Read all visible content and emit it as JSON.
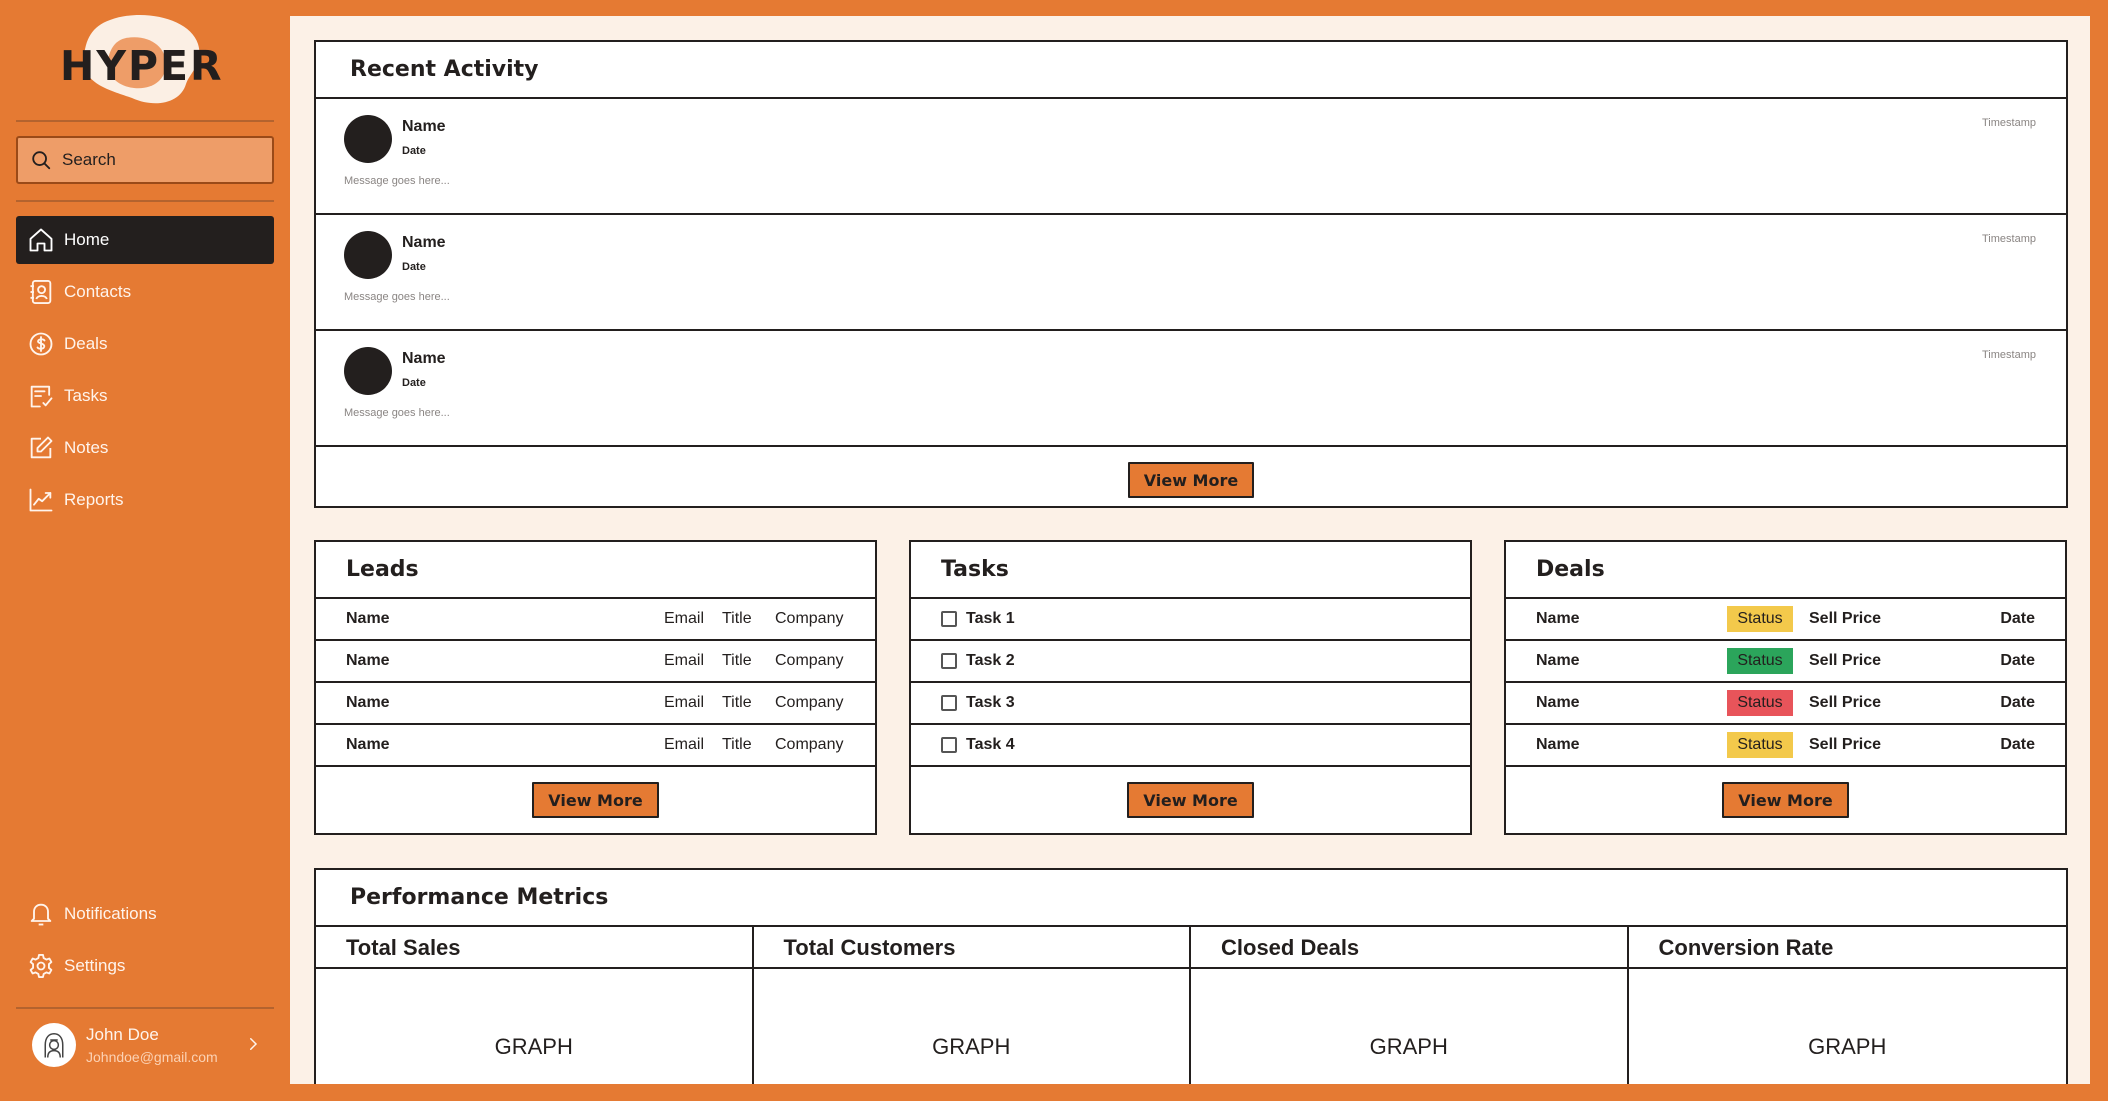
{
  "colors": {
    "brand": "#E57A33",
    "dark": "#231F1E",
    "panel": "#FCF1E7",
    "status_yellow": "#F3C94B",
    "status_green": "#2BA55B",
    "status_red": "#E8545A"
  },
  "logo": {
    "text": "HYPER"
  },
  "search": {
    "placeholder": "Search"
  },
  "nav": {
    "items": [
      {
        "label": "Home",
        "icon": "home-icon",
        "active": true
      },
      {
        "label": "Contacts",
        "icon": "contacts-icon"
      },
      {
        "label": "Deals",
        "icon": "dollar-icon"
      },
      {
        "label": "Tasks",
        "icon": "tasks-icon"
      },
      {
        "label": "Notes",
        "icon": "edit-icon"
      },
      {
        "label": "Reports",
        "icon": "chart-line-icon"
      }
    ],
    "bottom": [
      {
        "label": "Notifications",
        "icon": "bell-icon"
      },
      {
        "label": "Settings",
        "icon": "gear-icon"
      }
    ]
  },
  "user": {
    "name": "John Doe",
    "email": "Johndoe@gmail.com"
  },
  "recent_activity": {
    "title": "Recent Activity",
    "items": [
      {
        "name": "Name",
        "date": "Date",
        "message": "Message goes here...",
        "timestamp": "Timestamp"
      },
      {
        "name": "Name",
        "date": "Date",
        "message": "Message goes here...",
        "timestamp": "Timestamp"
      },
      {
        "name": "Name",
        "date": "Date",
        "message": "Message goes here...",
        "timestamp": "Timestamp"
      }
    ],
    "button": "View More"
  },
  "leads": {
    "title": "Leads",
    "rows": [
      {
        "name": "Name",
        "email": "Email",
        "title": "Title",
        "company": "Company"
      },
      {
        "name": "Name",
        "email": "Email",
        "title": "Title",
        "company": "Company"
      },
      {
        "name": "Name",
        "email": "Email",
        "title": "Title",
        "company": "Company"
      },
      {
        "name": "Name",
        "email": "Email",
        "title": "Title",
        "company": "Company"
      }
    ],
    "button": "View More"
  },
  "tasks": {
    "title": "Tasks",
    "items": [
      {
        "label": "Task 1"
      },
      {
        "label": "Task 2"
      },
      {
        "label": "Task 3"
      },
      {
        "label": "Task 4"
      }
    ],
    "button": "View More"
  },
  "deals": {
    "title": "Deals",
    "rows": [
      {
        "name": "Name",
        "status": "Status",
        "status_color": "#F3C94B",
        "price": "Sell Price",
        "date": "Date"
      },
      {
        "name": "Name",
        "status": "Status",
        "status_color": "#2BA55B",
        "price": "Sell Price",
        "date": "Date"
      },
      {
        "name": "Name",
        "status": "Status",
        "status_color": "#E8545A",
        "price": "Sell Price",
        "date": "Date"
      },
      {
        "name": "Name",
        "status": "Status",
        "status_color": "#F3C94B",
        "price": "Sell Price",
        "date": "Date"
      }
    ],
    "button": "View More"
  },
  "metrics": {
    "title": "Performance Metrics",
    "columns": [
      {
        "title": "Total Sales",
        "graph": "GRAPH"
      },
      {
        "title": "Total Customers",
        "graph": "GRAPH"
      },
      {
        "title": "Closed Deals",
        "graph": "GRAPH"
      },
      {
        "title": "Conversion Rate",
        "graph": "GRAPH"
      }
    ]
  }
}
